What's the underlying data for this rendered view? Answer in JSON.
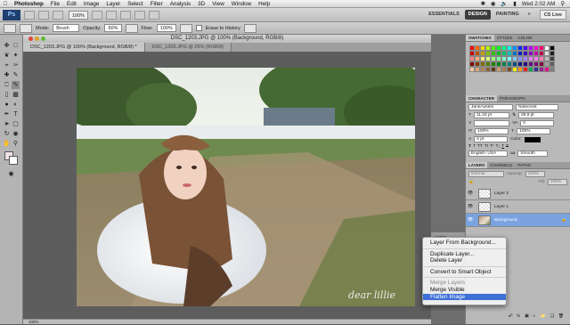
{
  "menubar": {
    "items": [
      "Photoshop",
      "File",
      "Edit",
      "Image",
      "Layer",
      "Select",
      "Filter",
      "Analysis",
      "3D",
      "View",
      "Window",
      "Help"
    ],
    "clock": "Wed 2:02 AM"
  },
  "appbar": {
    "logo": "Ps",
    "zoom": "100%",
    "workspaces": [
      "ESSENTIALS",
      "DESIGN",
      "PAINTING"
    ],
    "active_workspace": "DESIGN",
    "cs_live": "CS Live"
  },
  "options": {
    "mode_label": "Mode:",
    "mode_value": "Brush",
    "opacity_label": "Opacity:",
    "opacity_value": "60%",
    "flow_label": "Flow:",
    "flow_value": "100%",
    "erase_history": "Erase to History"
  },
  "document": {
    "title": "DSC_1203.JPG @ 100% (Background, RGB/8)",
    "tabs": [
      {
        "label": "DSC_1203.JPG @ 100% (Background, RGB/8) *",
        "active": true
      },
      {
        "label": "DSC_1205.JPG @ 25% (RGB/8)",
        "active": false
      }
    ],
    "status_zoom": "100%",
    "watermark": "dear lillie"
  },
  "panels": {
    "swatch_tabs": [
      "SWATCHES",
      "STYLES",
      "COLOR"
    ],
    "swatch_colors": [
      "#ff0000",
      "#ff6a00",
      "#ffd800",
      "#b6ff00",
      "#4cff00",
      "#00ff21",
      "#00ff90",
      "#00ffff",
      "#0094ff",
      "#0026ff",
      "#4800ff",
      "#b200ff",
      "#ff00dc",
      "#ff006e",
      "#ffffff",
      "#000000",
      "#c00000",
      "#c05000",
      "#c0a000",
      "#80c000",
      "#30c000",
      "#00c020",
      "#00c070",
      "#00c0c0",
      "#0070c0",
      "#0020c0",
      "#3800c0",
      "#8800c0",
      "#c000a8",
      "#c00050",
      "#e0e0e0",
      "#202020",
      "#ff8080",
      "#ffb080",
      "#ffe880",
      "#d8ff80",
      "#a0ff80",
      "#80ffa0",
      "#80ffd0",
      "#80ffff",
      "#80c8ff",
      "#8090ff",
      "#a880ff",
      "#e080ff",
      "#ff80ee",
      "#ff80b0",
      "#c0c0c0",
      "#404040",
      "#800000",
      "#803800",
      "#806c00",
      "#568000",
      "#208000",
      "#008018",
      "#008048",
      "#008080",
      "#004c80",
      "#001880",
      "#280080",
      "#5c0080",
      "#800070",
      "#800038",
      "#a0a0a0",
      "#606060",
      "#f4c7a0",
      "#d9a67a",
      "#b88458",
      "#8c6239",
      "#603913",
      "#c69c6d",
      "#a67c52",
      "#754c24",
      "#fff200",
      "#f7941d",
      "#ed1c24",
      "#00a651",
      "#2e3192",
      "#92278f",
      "#ec008c",
      "#808080"
    ],
    "char_tabs": [
      "CHARACTER",
      "PARAGRAPH"
    ],
    "font_family": "JaneAusten",
    "font_style": "Notecrest",
    "font_size": "11.23 pt",
    "leading": "28.8 pt",
    "tracking": "0",
    "vscale": "100%",
    "hscale": "100%",
    "baseline": "0 pt",
    "color_label": "Color:",
    "language": "English: USA",
    "antialias": "Smooth",
    "aa_label": "aa",
    "layer_tabs": [
      "LAYERS",
      "CHANNELS",
      "PATHS"
    ],
    "blend_mode": "Normal",
    "opacity_label": "Opacity:",
    "opacity_value": "100%",
    "fill_label": "Fill:",
    "fill_value": "100%",
    "layers": [
      {
        "name": "Layer 2",
        "selected": false
      },
      {
        "name": "Layer 1",
        "selected": false
      },
      {
        "name": "Background",
        "selected": true
      }
    ],
    "actions_label": "ACTIO"
  },
  "context_menu": {
    "items": [
      {
        "label": "Layer From Background...",
        "disabled": false,
        "highlight": false
      },
      {
        "sep": true
      },
      {
        "label": "Duplicate Layer...",
        "disabled": false,
        "highlight": false
      },
      {
        "label": "Delete Layer",
        "disabled": false,
        "highlight": false
      },
      {
        "sep": true
      },
      {
        "label": "Convert to Smart Object",
        "disabled": false,
        "highlight": false
      },
      {
        "sep": true
      },
      {
        "label": "Merge Layers",
        "disabled": true,
        "highlight": false
      },
      {
        "label": "Merge Visible",
        "disabled": false,
        "highlight": false
      },
      {
        "label": "Flatten Image",
        "disabled": false,
        "highlight": true
      }
    ]
  }
}
